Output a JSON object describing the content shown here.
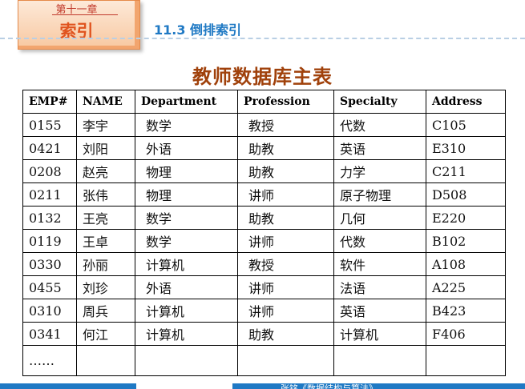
{
  "chapter": {
    "number": "第十一章",
    "name": "索引"
  },
  "section": {
    "title": "11.3 倒排索引"
  },
  "table": {
    "title": "教师数据库主表",
    "headers": [
      "EMP#",
      "NAME",
      "Department",
      "Profession",
      "Specialty",
      "Address"
    ],
    "rows": [
      [
        "0155",
        "李宇",
        "数学",
        "教授",
        "代数",
        "C105"
      ],
      [
        "0421",
        "刘阳",
        "外语",
        "助教",
        "英语",
        "E310"
      ],
      [
        "0208",
        "赵亮",
        "物理",
        "助教",
        "力学",
        "C211"
      ],
      [
        "0211",
        "张伟",
        "物理",
        "讲师",
        "原子物理",
        "D508"
      ],
      [
        "0132",
        "王亮",
        "数学",
        "助教",
        "几何",
        "E220"
      ],
      [
        "0119",
        "王卓",
        "数学",
        "讲师",
        "代数",
        "B102"
      ],
      [
        "0330",
        "孙丽",
        "计算机",
        "教授",
        "软件",
        "A108"
      ],
      [
        "0455",
        "刘珍",
        "外语",
        "讲师",
        "法语",
        "A225"
      ],
      [
        "0310",
        "周兵",
        "计算机",
        "讲师",
        "英语",
        "B423"
      ],
      [
        "0341",
        "何江",
        "计算机",
        "助教",
        "计算机",
        "F406"
      ]
    ],
    "ellipsis": "……"
  },
  "footer": {
    "text": "张铭《数据结构与算法》"
  },
  "colors": {
    "accent_orange": "#e0531e",
    "accent_blue": "#1f79c4",
    "title_brown": "#a0410b"
  }
}
